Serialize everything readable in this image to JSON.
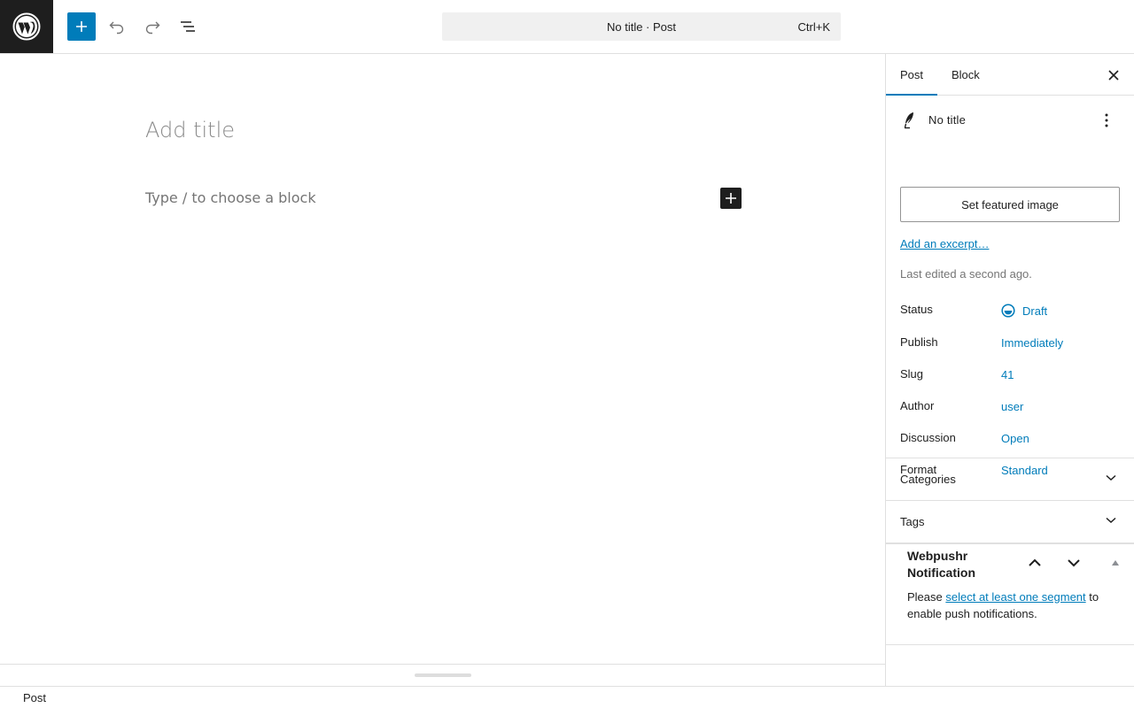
{
  "header": {
    "command_title": "No title · Post",
    "command_shortcut": "Ctrl+K"
  },
  "editor": {
    "title_placeholder": "Add title",
    "block_placeholder": "Type / to choose a block"
  },
  "footer": {
    "breadcrumb": "Post"
  },
  "sidebar": {
    "tabs": [
      {
        "label": "Post"
      },
      {
        "label": "Block"
      }
    ],
    "document": {
      "title": "No title"
    },
    "featured_image_label": "Set featured image",
    "excerpt_label": "Add an excerpt…",
    "last_edited": "Last edited a second ago.",
    "meta": [
      {
        "label": "Status",
        "value": "Draft"
      },
      {
        "label": "Publish",
        "value": "Immediately"
      },
      {
        "label": "Slug",
        "value": "41"
      },
      {
        "label": "Author",
        "value": "user"
      },
      {
        "label": "Discussion",
        "value": "Open"
      },
      {
        "label": "Format",
        "value": "Standard"
      }
    ],
    "panels": [
      {
        "title": "Categories"
      },
      {
        "title": "Tags"
      }
    ],
    "webpushr": {
      "title": "Webpushr Notification",
      "body_before": "Please ",
      "body_link": "select at least one segment",
      "body_after": " to enable push notifications."
    }
  },
  "colors": {
    "accent": "#007cba",
    "dark": "#1e1e1e"
  }
}
